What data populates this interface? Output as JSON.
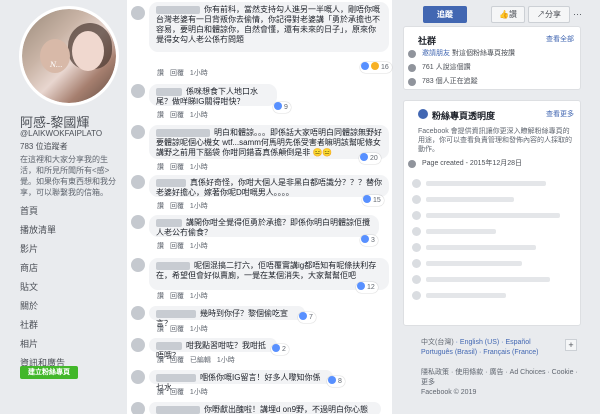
{
  "page": {
    "name": "阿感-黎國輝",
    "handle": "@LAIKWOKFAIPLATO",
    "likes": "783 位追蹤者",
    "description": "在這裡和大家分享我的生活，和所見所聞所有<感>覺。如果你有東西想和我分享，可以聯繫我的信箱。",
    "avatar_watermark": "N..."
  },
  "nav": [
    "首頁",
    "播放清單",
    "影片",
    "商店",
    "貼文",
    "關於",
    "社群",
    "相片",
    "資訊和廣告"
  ],
  "create_page_label": "建立粉絲專頁",
  "top_actions": {
    "follow": "追蹤",
    "like": "讚",
    "share": "分享",
    "more": "···"
  },
  "community": {
    "title": "社群",
    "see_all": "查看全部",
    "invite_prefix": "邀請朋友",
    "invite_suffix": "對這個粉絲專頁按讚",
    "likes_count": "761 人說這個讚",
    "follows_count": "783 個人正在追蹤"
  },
  "transparency": {
    "title": "粉絲專頁透明度",
    "see_more": "查看更多",
    "description": "Facebook 會提供資訊讓你更深入瞭解粉絲專頁的用途，你可以查看負責管理和發佈內容的人採取的動作。",
    "created": "Page created - 2015年12月28日"
  },
  "languages": {
    "current": "中文(台灣)",
    "others": [
      "English (US)",
      "Español",
      "Português (Brasil)",
      "Français (France)"
    ],
    "plus": "+"
  },
  "footer": {
    "links": "隱私政策 · 使用條款 · 廣告 · Ad Choices · Cookie · 更多",
    "copyright": "Facebook © 2019"
  },
  "comments": [
    {
      "text": "你有前科，當然支持勾人進另一半嘅人，剛唔你嘅台灣老婆有一日背叛你去偷情，你記得對老婆講「勇於承擔也不容易，要明白和體諒你，自然會懂，還有未來的日子」，原來你覺得女勾人老公係冇問題",
      "meta": [
        "讚",
        "回覆",
        "1小時"
      ],
      "react": "16"
    },
    {
      "text": "係咪想食下人地口水尾？做咩睇IG關得咁快？",
      "meta": [
        "讚",
        "回覆",
        "1小時"
      ],
      "react": "9"
    },
    {
      "text": "明白和體諒。。。即係話大家唔明白同體諒無野好要體諒呢個心機女 wtf...samm何馬明先係受害者嘛明該幫呢條女講野之前用下腦袋 你咁同錯喜真係顛倒是非 😑😑",
      "meta": [
        "讚",
        "回覆",
        "1小時"
      ],
      "react": "20"
    },
    {
      "text": "真係好奇怪，你咁大個人是非黑白都唔識分？？？替你老婆好擔心，嫁著你呢D咁嘅男人。。。。",
      "meta": [
        "讚",
        "回覆",
        "1小時"
      ],
      "react": "15"
    },
    {
      "text": "講開你咁全覺得佢勇於承擔？即係你明白明體諒佢攬人老公冇偷食？",
      "meta": [
        "讚",
        "回覆",
        "1小時"
      ],
      "react": "3"
    },
    {
      "text": "呢個混搞二打六，佢唔覆實講ig都唔知有呢條扶利存在，希望但會好似賣廁，一覺在某個消失，大家幫幫佢吧",
      "meta": [
        "讚",
        "回覆",
        "1小時"
      ],
      "react": "12"
    },
    {
      "text": "幾時到你仔？黎個偷吃宣言？",
      "meta": [
        "讚",
        "回覆",
        "1小時"
      ],
      "react": "7"
    },
    {
      "text": "咁我點習咁咗？我咁抵唔哦？",
      "meta": [
        "讚",
        "回覆",
        "已編輯",
        "1小時"
      ],
      "react": "2"
    },
    {
      "text": "嗰係你嘅IG留言！好多人嚟知你係乜水",
      "meta": [
        "讚",
        "回覆",
        "1小時"
      ],
      "react": "8"
    },
    {
      "text": "你嘢獻出醜啦！講埋d on9野，不過明白你心態",
      "meta": [],
      "react": ""
    }
  ]
}
